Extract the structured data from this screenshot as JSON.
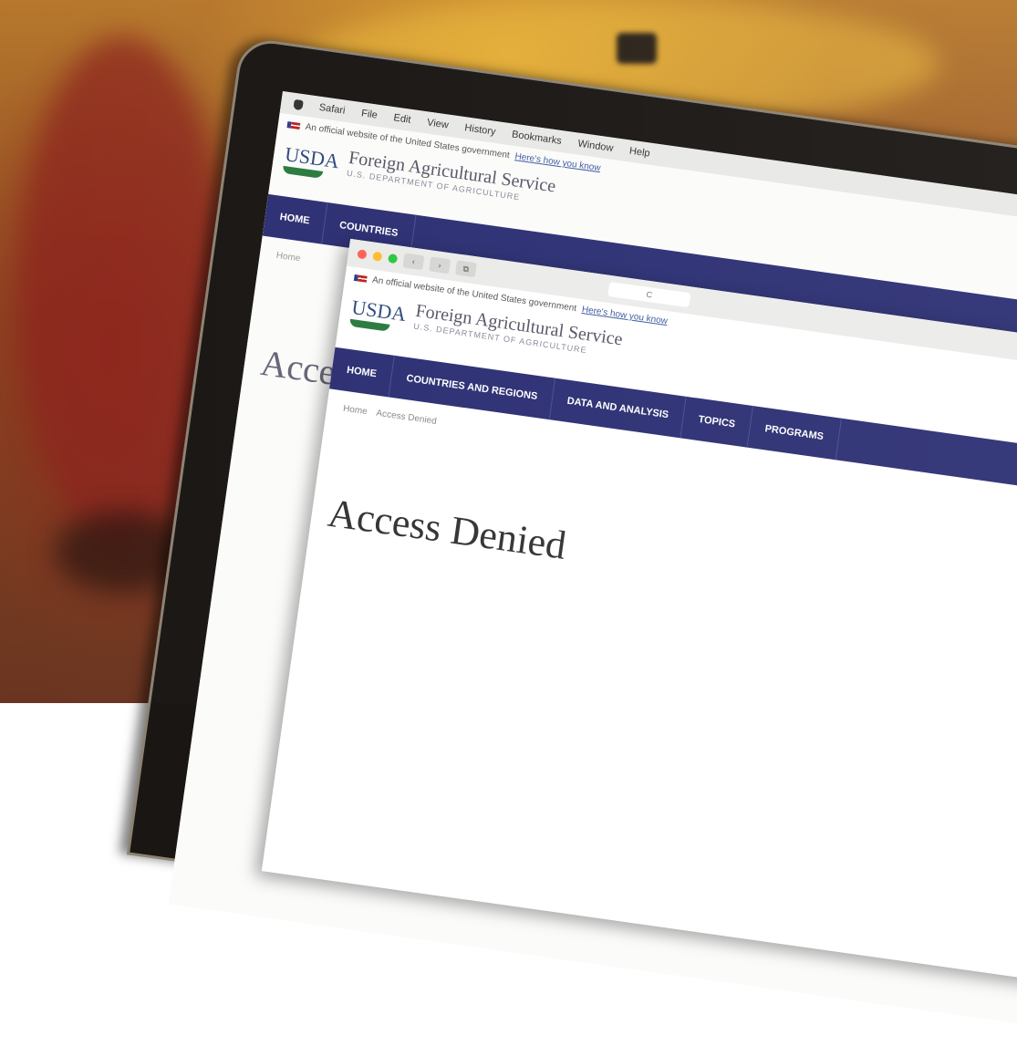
{
  "menubar": {
    "items": [
      "Safari",
      "File",
      "Edit",
      "View",
      "History",
      "Bookmarks",
      "Window",
      "Help"
    ]
  },
  "site": {
    "official_notice": "An official website of the United States government",
    "official_link": "Here's how you know",
    "usda": "USDA",
    "agency": "Foreign Agricultural Service",
    "agency_sub": "U.S. DEPARTMENT OF AGRICULTURE",
    "nav": [
      "HOME",
      "COUNTRIES AND REGIONS",
      "DATA AND ANALYSIS",
      "TOPICS",
      "PROGRAMS"
    ],
    "back_nav": [
      "HOME",
      "COUNTRIES"
    ],
    "breadcrumb_home": "Home",
    "breadcrumb_current": "Access Denied",
    "page_title": "Access Denied",
    "back_title": "Access"
  },
  "browser": {
    "back_label": "‹",
    "forward_label": "›",
    "tab_button": "⧉",
    "address": "C"
  },
  "colors": {
    "nav_bg": "#2c2f73",
    "usda_green": "#2a7a3e",
    "dot_red": "#ff5f57",
    "dot_yellow": "#febc2e",
    "dot_green": "#28c840"
  }
}
